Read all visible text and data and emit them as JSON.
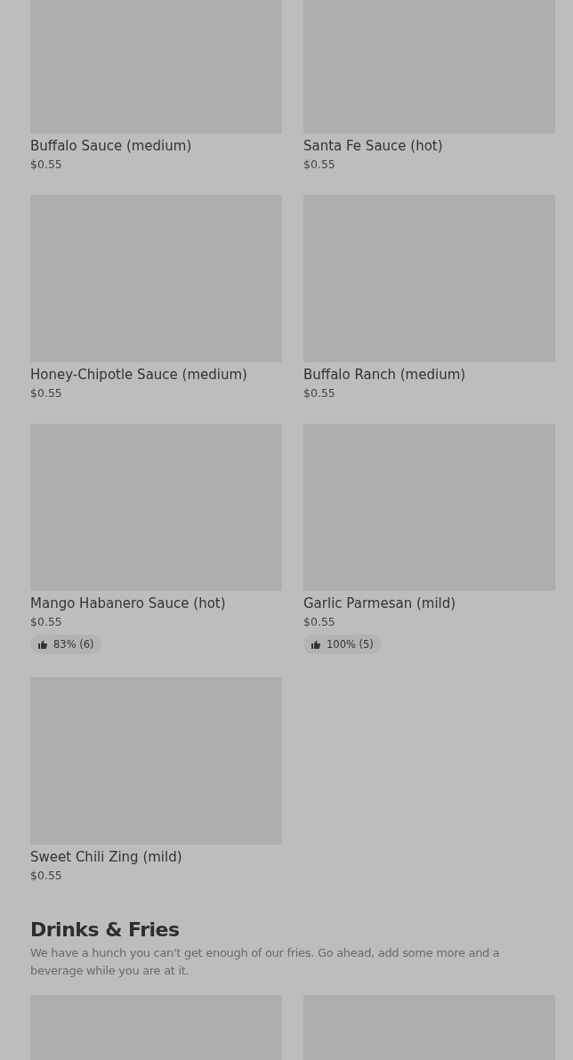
{
  "sections": [
    {
      "items": [
        {
          "name": "Buffalo Sauce (medium)",
          "price": "$0.55"
        },
        {
          "name": "Santa Fe Sauce (hot)",
          "price": "$0.55"
        },
        {
          "name": "Honey-Chipotle Sauce (medium)",
          "price": "$0.55"
        },
        {
          "name": "Buffalo Ranch (medium)",
          "price": "$0.55"
        },
        {
          "name": "Mango Habanero Sauce (hot)",
          "price": "$0.55",
          "rating": "83% (6)"
        },
        {
          "name": "Garlic Parmesan (mild)",
          "price": "$0.55",
          "rating": "100% (5)"
        },
        {
          "name": "Sweet Chili Zing (mild)",
          "price": "$0.55"
        }
      ]
    },
    {
      "title": "Drinks & Fries",
      "description": "We have a hunch you can't get enough of our fries. Go ahead, add some more and a beverage while you are at it.",
      "items": [
        {
          "kind": "image"
        },
        {
          "kind": "image"
        }
      ]
    }
  ]
}
